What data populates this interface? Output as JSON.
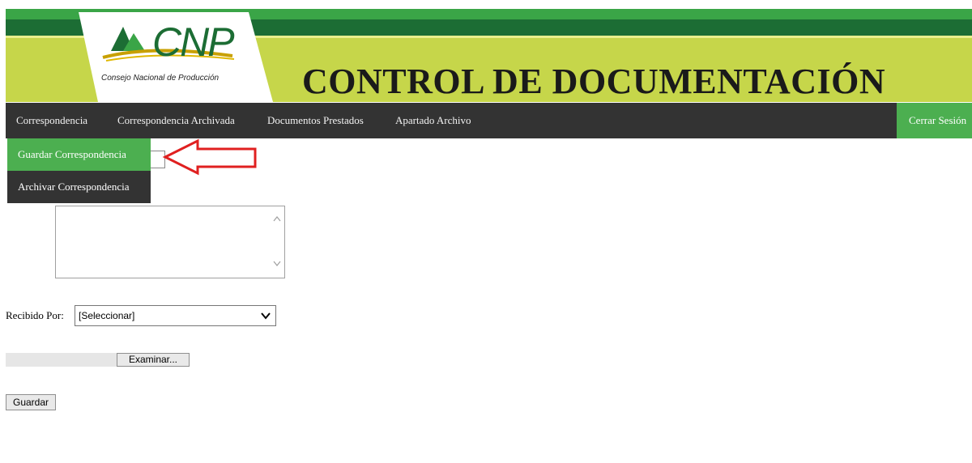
{
  "header": {
    "logo_mark": "CNP",
    "logo_subtitle": "Consejo Nacional de Producción",
    "title": "CONTROL DE DOCUMENTACIÓN"
  },
  "nav": {
    "items": [
      {
        "label": "Correspondencia"
      },
      {
        "label": "Correspondencia Archivada"
      },
      {
        "label": "Documentos Prestados"
      },
      {
        "label": "Apartado Archivo"
      }
    ],
    "logout_label": "Cerrar Sesión"
  },
  "dropdown": {
    "items": [
      {
        "label": "Guardar Correspondencia"
      },
      {
        "label": "Archivar Correspondencia"
      }
    ]
  },
  "form": {
    "recibido_label": "Recibido Por:",
    "recibido_value": "[Seleccionar]",
    "file_button_label": "Examinar...",
    "save_label": "Guardar"
  },
  "colors": {
    "banner": "#c6d64a",
    "nav_bg": "#333333",
    "accent_green": "#4caf50",
    "annotation_arrow": "#e02020"
  }
}
